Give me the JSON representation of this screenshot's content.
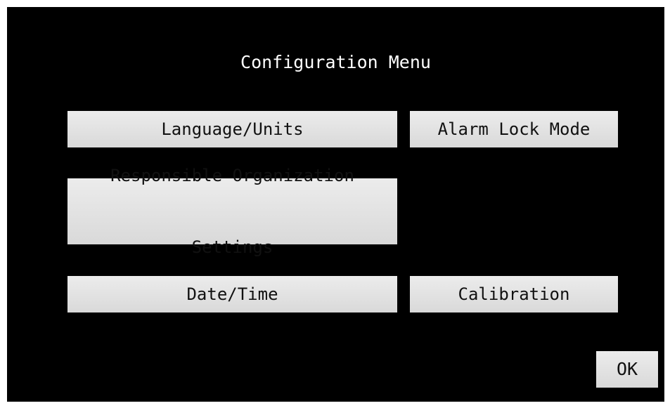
{
  "screen": {
    "title": "Configuration Menu",
    "background_color": "#000000",
    "button_color": "#e3e3e3"
  },
  "buttons": {
    "language_units": "Language/Units",
    "alarm_lock_mode": "Alarm Lock Mode",
    "responsible_org_line1": "Responsible Organization",
    "responsible_org_line2": "Settings",
    "date_time": "Date/Time",
    "calibration": "Calibration",
    "ok": "OK"
  }
}
